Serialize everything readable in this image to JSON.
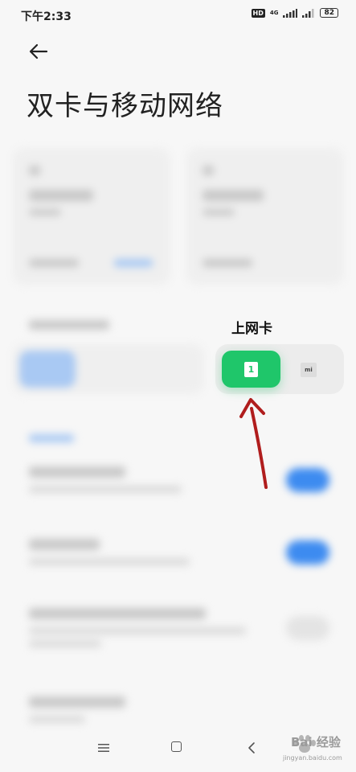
{
  "status_bar": {
    "time": "下午2:33",
    "hd": "HD",
    "network": "4G",
    "battery": "82"
  },
  "page": {
    "title": "双卡与移动网络"
  },
  "data_sim_picker": {
    "label": "上网卡",
    "sim1_label": "1",
    "sim2_label": "mi"
  },
  "watermark": {
    "text": "Bai 经验",
    "url": "jingyan.baidu.com"
  },
  "colors": {
    "accent_green": "#1fc66a",
    "toggle_blue": "#3d8bf0",
    "arrow_red": "#b01d1d"
  }
}
